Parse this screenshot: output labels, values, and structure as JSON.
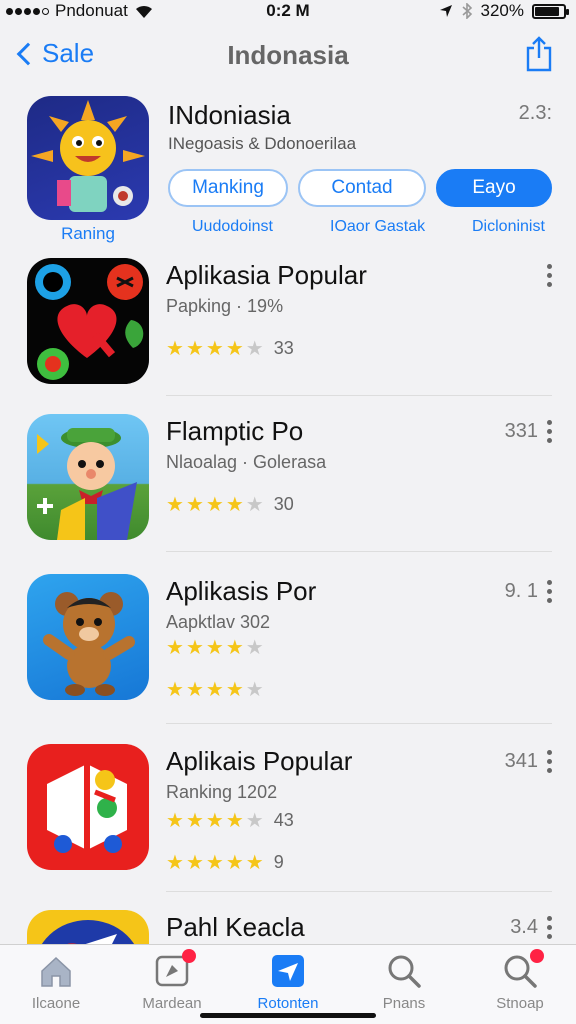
{
  "status": {
    "carrier": "Pndonuat",
    "time": "0:2 M",
    "battery": "320%",
    "battery_level": 0.85
  },
  "nav": {
    "back_label": "Sale",
    "title": "Indonasia"
  },
  "featured": {
    "title": "INdoniasia",
    "subtitle": "INegoasis & Ddonoerilaa",
    "number": "2.3:",
    "icon_label": "Raning",
    "buttons": [
      "Manking",
      "Contad",
      "Eayo"
    ],
    "links": [
      "Uudodoinst",
      "IOaor Gastak",
      "Dicloninist"
    ]
  },
  "rows": [
    {
      "title": "Aplikasia Popular",
      "subtitle": "Papking ·  19%",
      "number": "",
      "rating": 4,
      "count": "33",
      "show_more": true
    },
    {
      "title": "Flamptic Po",
      "subtitle": "Nlaoalag ·  Golerasa",
      "number": "331",
      "rating": 4,
      "count": "30",
      "show_more": true
    },
    {
      "title": "Aplikasis Por",
      "subtitle": "Aapktlav    302",
      "number": "9. 1",
      "rating": 4,
      "count": "",
      "rating2": 4,
      "count2": "",
      "show_more": true
    },
    {
      "title": "Aplikais Popular",
      "subtitle": "Ranking    1202",
      "number": "341",
      "rating": 4,
      "count": "43",
      "rating2": 4.5,
      "count2": "9",
      "show_more": true
    },
    {
      "title": "Pahl Keacla",
      "subtitle": "",
      "number": "3.4",
      "rating": 0,
      "count": "",
      "show_more": true
    }
  ],
  "tabs": [
    {
      "label": "Ilcaone",
      "icon": "home-icon",
      "badge": false
    },
    {
      "label": "Mardean",
      "icon": "compass-icon",
      "badge": true
    },
    {
      "label": "Rotonten",
      "icon": "apps-icon",
      "badge": false,
      "active": true
    },
    {
      "label": "Pnans",
      "icon": "search-icon",
      "badge": false
    },
    {
      "label": "Stnoap",
      "icon": "search-icon",
      "badge": true
    }
  ]
}
